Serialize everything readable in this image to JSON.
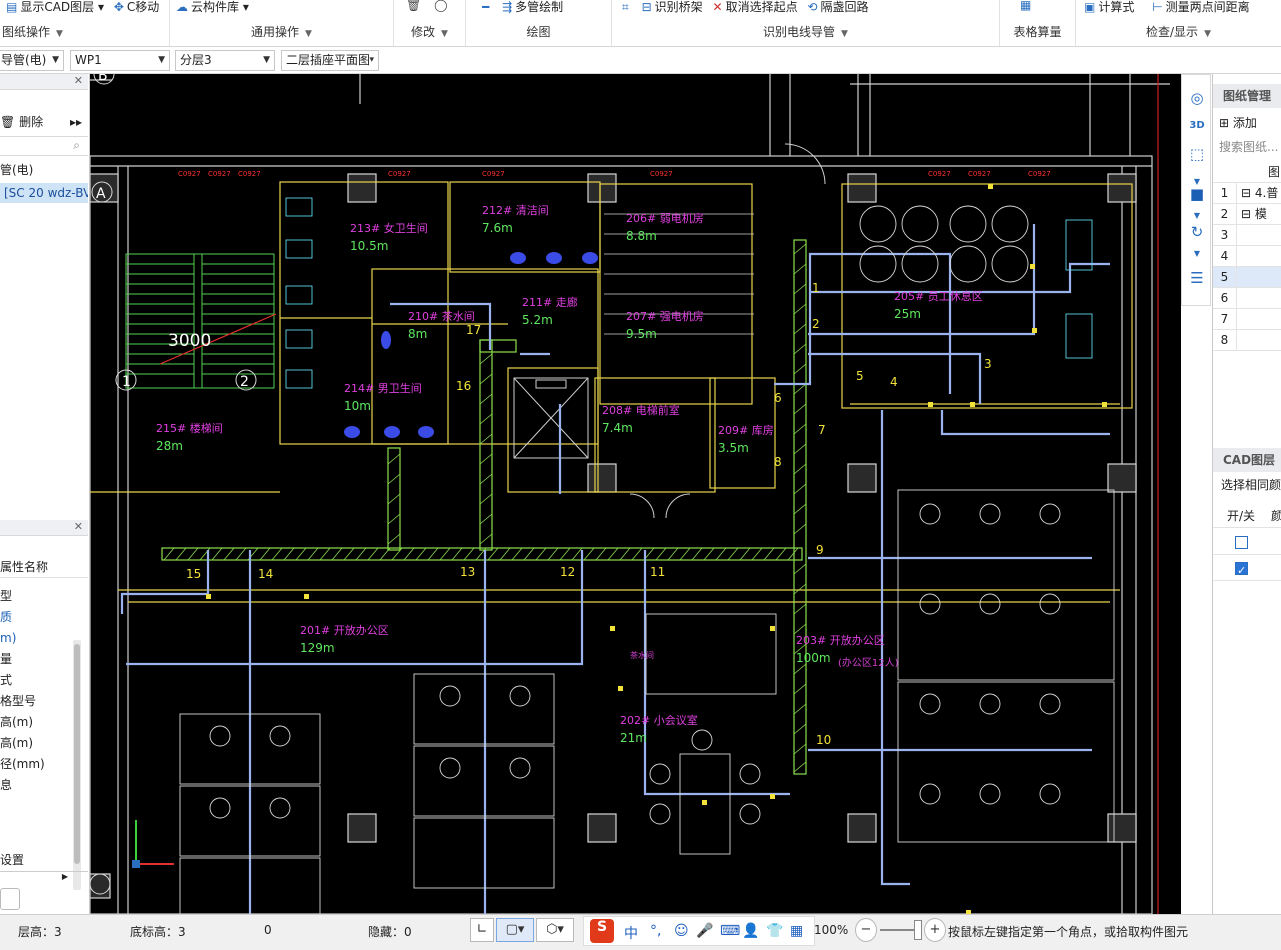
{
  "ribbon": {
    "groups": [
      {
        "title": "图纸操作",
        "buttons": [
          "显示CAD图层",
          "C移动"
        ]
      },
      {
        "title": "通用操作",
        "buttons": [
          "云构件库"
        ]
      },
      {
        "title": "修改",
        "buttons": []
      },
      {
        "title": "绘图",
        "buttons": [
          "多管绘制"
        ]
      },
      {
        "title": "识别电线导管",
        "buttons": [
          "识别桥架",
          "取消选择起点",
          "隔盏回路"
        ]
      },
      {
        "title": "表格算量",
        "buttons": []
      },
      {
        "title": "检查/显示",
        "buttons": [
          "计算式",
          "测量两点间距离"
        ]
      }
    ]
  },
  "toolbar": {
    "type_select": "导管(电)",
    "component_select": "WP1",
    "layer_select": "分层3",
    "drawing_select": "二层插座平面图"
  },
  "left_panel": {
    "tree_section": {
      "delete_label": "删除",
      "search_icon": "search-icon",
      "tree_root": "管(电)",
      "tree_item": "[SC 20 wdz-BV"
    },
    "property_section": {
      "header": "属性名称",
      "rows": [
        "型",
        "质",
        "m)",
        "量",
        "式",
        "格型号",
        "高(m)",
        "高(m)",
        "径(mm)",
        "息"
      ],
      "blue_rows": [
        1,
        2
      ],
      "footer": "设置"
    }
  },
  "canvas": {
    "rooms": [
      {
        "no": "213#",
        "name": "女卫生间",
        "area": "10.5m"
      },
      {
        "no": "212#",
        "name": "清洁间",
        "area": "7.6m"
      },
      {
        "no": "206#",
        "name": "弱电机房",
        "area": "8.8m"
      },
      {
        "no": "210#",
        "name": "茶水间",
        "area": "8m"
      },
      {
        "no": "211#",
        "name": "走廊",
        "area": "5.2m"
      },
      {
        "no": "207#",
        "name": "强电机房",
        "area": "9.5m"
      },
      {
        "no": "214#",
        "name": "男卫生间",
        "area": "10m"
      },
      {
        "no": "215#",
        "name": "楼梯间",
        "area": "28m"
      },
      {
        "no": "208#",
        "name": "电梯前室",
        "area": "7.4m"
      },
      {
        "no": "209#",
        "name": "库房",
        "area": "3.5m"
      },
      {
        "no": "205#",
        "name": "员工休息区",
        "area": "25m"
      },
      {
        "no": "201#",
        "name": "开放办公区",
        "area": "129m"
      },
      {
        "no": "203#",
        "name": "开放办公区",
        "area": "100m"
      },
      {
        "no": "202#",
        "name": "小会议室",
        "area": "21m"
      }
    ],
    "dimension": "3000",
    "axis_labels": [
      "A",
      "B",
      "1",
      "2"
    ],
    "circuit_numbers": [
      "1",
      "2",
      "3",
      "4",
      "5",
      "6",
      "7",
      "8",
      "9",
      "10",
      "11",
      "12",
      "13",
      "14",
      "15",
      "16",
      "17"
    ],
    "sub_notes": [
      "茶水间",
      "(办公区12人)"
    ]
  },
  "right_panel": {
    "drawing_mgmt_title": "图纸管理",
    "add_label": "添加",
    "search_placeholder": "搜索图纸...",
    "col_header": "图",
    "rows": [
      {
        "n": "1",
        "label": "4.普"
      },
      {
        "n": "2",
        "label": "模"
      },
      {
        "n": "3",
        "label": ""
      },
      {
        "n": "4",
        "label": ""
      },
      {
        "n": "5",
        "label": ""
      },
      {
        "n": "6",
        "label": ""
      },
      {
        "n": "7",
        "label": ""
      },
      {
        "n": "8",
        "label": ""
      }
    ],
    "cad_layers_title": "CAD图层",
    "select_same_label": "选择相同颜",
    "onoff_header": "开/关",
    "color_header": "颜",
    "layer_rows": [
      {
        "checked": false
      },
      {
        "checked": true
      }
    ]
  },
  "status": {
    "floor_height": "层高：3",
    "base_height": "底标高：3",
    "zero": "0",
    "hidden": "隐藏：0",
    "zoom": "100%",
    "hint": "按鼠标左键指定第一个角点，或拾取构件图元"
  }
}
